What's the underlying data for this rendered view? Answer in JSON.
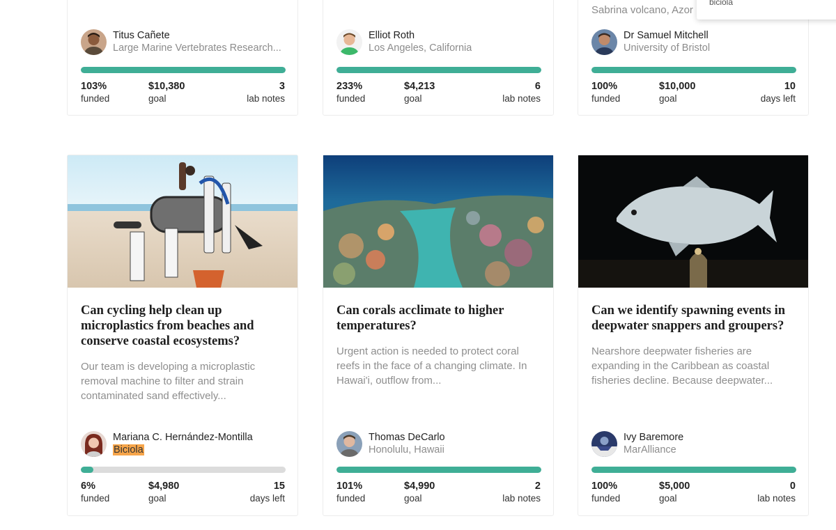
{
  "top_cards": [
    {
      "researcher": {
        "name": "Titus Cañete",
        "affiliation": "Large Marine Vertebrates Research..."
      },
      "funded_pct": 103,
      "stats": {
        "funded": "103%",
        "funded_label": "funded",
        "goal": "$10,380",
        "goal_label": "goal",
        "third": "3",
        "third_label": "lab notes"
      }
    },
    {
      "researcher": {
        "name": "Elliot Roth",
        "affiliation": "Los Angeles, California"
      },
      "funded_pct": 233,
      "stats": {
        "funded": "233%",
        "funded_label": "funded",
        "goal": "$4,213",
        "goal_label": "goal",
        "third": "6",
        "third_label": "lab notes"
      }
    },
    {
      "clipped_text": "Sabrina volcano, Azor",
      "researcher": {
        "name": "Dr Samuel Mitchell",
        "affiliation": "University of Bristol"
      },
      "funded_pct": 100,
      "stats": {
        "funded": "100%",
        "funded_label": "funded",
        "goal": "$10,000",
        "goal_label": "goal",
        "third": "10",
        "third_label": "days left"
      }
    }
  ],
  "bottom_cards": [
    {
      "title": "Can cycling help clean up microplastics from beaches and conserve coastal ecosystems?",
      "description": "Our team is developing a microplastic removal machine to filter and strain contaminated sand effectively...",
      "researcher": {
        "name": "Mariana C. Hernández-Montilla",
        "affiliation": "Biciola"
      },
      "funded_pct": 6,
      "stats": {
        "funded": "6%",
        "funded_label": "funded",
        "goal": "$4,980",
        "goal_label": "goal",
        "third": "15",
        "third_label": "days left"
      }
    },
    {
      "title": "Can corals acclimate to higher temperatures?",
      "description": "Urgent action is needed to protect coral reefs in the face of a changing climate. In Hawai'i, outflow from...",
      "researcher": {
        "name": "Thomas DeCarlo",
        "affiliation": "Honolulu, Hawaii"
      },
      "funded_pct": 101,
      "stats": {
        "funded": "101%",
        "funded_label": "funded",
        "goal": "$4,990",
        "goal_label": "goal",
        "third": "2",
        "third_label": "lab notes"
      }
    },
    {
      "title": "Can we identify spawning events in deepwater snappers and groupers?",
      "description": "Nearshore deepwater fisheries are expanding in the Caribbean as coastal fisheries decline. Because deepwater...",
      "researcher": {
        "name": "Ivy Baremore",
        "affiliation": "MarAlliance"
      },
      "funded_pct": 100,
      "stats": {
        "funded": "100%",
        "funded_label": "funded",
        "goal": "$5,000",
        "goal_label": "goal",
        "third": "0",
        "third_label": "lab notes"
      }
    }
  ],
  "dropdown": {
    "text": "biciola"
  },
  "colors": {
    "progress": "#3fae96",
    "track": "#dcdcdc",
    "highlight": "#f6a54a"
  }
}
